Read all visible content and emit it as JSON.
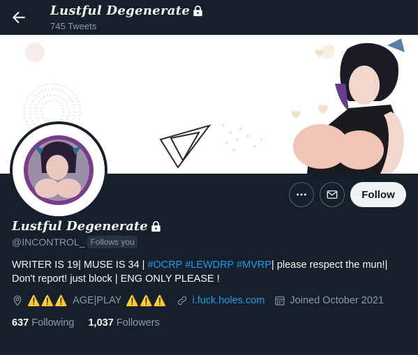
{
  "header": {
    "title": "Lustful Degenerate",
    "tweet_count": "745 Tweets"
  },
  "profile": {
    "name": "Lustful Degenerate",
    "handle": "@INCONTROL_",
    "follows_you": "Follows you",
    "bio": {
      "part1": "WRITER IS 19| MUSE IS 34 | ",
      "hashtags": "#OCRP #LEWDRP #MVRP",
      "part2": "| please respect the mun!| Don't report! just block | ENG ONLY PLEASE !"
    },
    "location": "AGE|PLAY",
    "warning_emojis": "⚠️⚠️⚠️",
    "website": "i.fuck.holes.com",
    "joined": "Joined October 2021",
    "following_count": "637",
    "following_label": "Following",
    "followers_count": "1,037",
    "followers_label": "Followers"
  },
  "actions": {
    "more_icon": "more-icon",
    "message_icon": "mail-icon",
    "follow_label": "Follow"
  },
  "colors": {
    "background": "#15202b",
    "accent": "#1d9bf0",
    "muted": "#8b98a5",
    "text": "#f7f9f9"
  }
}
